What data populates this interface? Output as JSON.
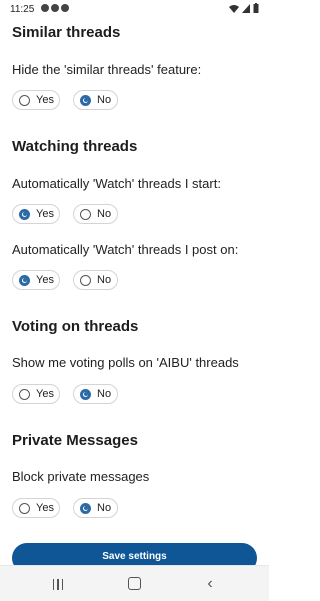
{
  "status_bar": {
    "time": "11:25",
    "notification_icons": [
      "notification-icon",
      "notification-icon",
      "notification-icon"
    ],
    "right_icons": [
      "wifi-icon",
      "signal-icon",
      "battery-icon"
    ]
  },
  "sections": [
    {
      "heading": "Similar threads",
      "questions": [
        {
          "label": "Hide the 'similar threads' feature:",
          "options": [
            "Yes",
            "No"
          ],
          "selected": "No"
        }
      ]
    },
    {
      "heading": "Watching threads",
      "questions": [
        {
          "label": "Automatically 'Watch' threads I start:",
          "options": [
            "Yes",
            "No"
          ],
          "selected": "Yes"
        },
        {
          "label": "Automatically 'Watch' threads I post on:",
          "options": [
            "Yes",
            "No"
          ],
          "selected": "Yes"
        }
      ]
    },
    {
      "heading": "Voting on threads",
      "questions": [
        {
          "label": "Show me voting polls on 'AIBU' threads",
          "options": [
            "Yes",
            "No"
          ],
          "selected": "No"
        }
      ]
    },
    {
      "heading": "Private Messages",
      "questions": [
        {
          "label": "Block private messages",
          "options": [
            "Yes",
            "No"
          ],
          "selected": "No"
        }
      ]
    }
  ],
  "save_button": {
    "label": "Save settings"
  },
  "colors": {
    "accent": "#2c6aa6",
    "save_button": "#0e5696"
  },
  "nav_bar": {
    "icons": [
      "recents-icon",
      "home-icon",
      "back-icon"
    ]
  }
}
